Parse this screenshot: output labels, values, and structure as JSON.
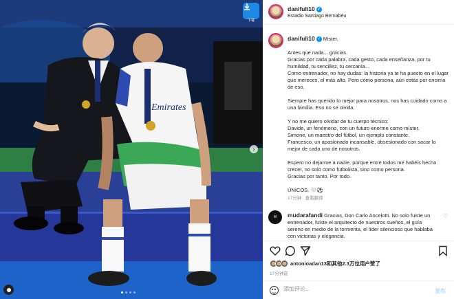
{
  "download_button": {
    "label": "下载"
  },
  "header": {
    "username": "danifuli10",
    "location": "Estadio Santiago Bernabéu"
  },
  "caption": {
    "username": "danifuli10",
    "paragraphs": [
      [
        "Mister,"
      ],
      [
        "Antes que nada... gracias.",
        "Gracias por cada palabra, cada gesto, cada enseñanza, por tu humildad, tu sencillez, tu cercanía...",
        "Como entrenador, no hay dudas: la historia ya te ha puesto en el lugar que mereces, el más alto. Pero como persona, aún estás por encima de eso."
      ],
      [
        "Siempre has querido lo mejor para nosotros, nos has cuidado como a una familia. Eso no se olvida."
      ],
      [
        "Y no me quiero olvidar de tu cuerpo técnico:",
        "Davide, un fenómeno, con un futuro enorme como míster.",
        "Simone, un maestro del fútbol, un ejemplo constante.",
        "Francesco, un apasionado incansable, obsesionado con sacar lo mejor de cada uno de nosotros."
      ],
      [
        "Espero no dejarme a nadie, porque entre todos me habéis hecho crecer, no solo como futbolista, sino como persona.",
        "Gracias por tanto. Por todo."
      ],
      [
        "ÚNICOS. 🤍⚽"
      ]
    ],
    "time": "17分钟",
    "translate": "查看翻译"
  },
  "comment": {
    "username": "mudarafandi",
    "text": "Gracias, Don Carlo Ancelotti. No solo fuiste un entrenador, fuiste el arquitecto de nuestros sueños, el guía sereno en medio de la tormenta, el líder silencioso que hablaba con victorias y elegancia."
  },
  "likes": {
    "text": "antonioadan13和其他2.3万位用户赞了",
    "time": "17分钟前"
  },
  "add_comment": {
    "placeholder": "添加评论...",
    "post_label": "发布"
  },
  "colors": {
    "accent": "#0095f6",
    "bg_photo": "#0d1f3c"
  },
  "icons": [
    "heart-icon",
    "comment-icon",
    "share-icon",
    "bookmark-icon",
    "emoji-icon",
    "download-icon"
  ]
}
